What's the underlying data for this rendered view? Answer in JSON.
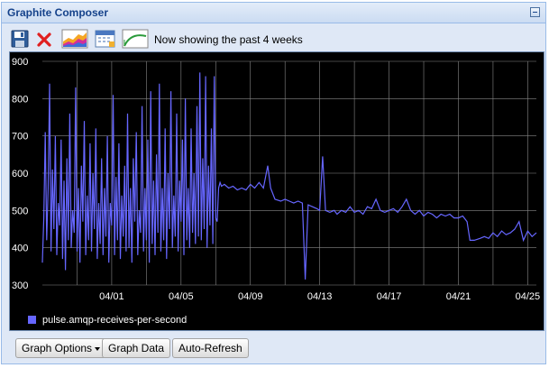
{
  "window": {
    "title": "Graphite Composer"
  },
  "toolbar": {
    "status": "Now showing the past 4 weeks",
    "icons": [
      "save-icon",
      "delete-icon",
      "graph-options-icon",
      "calendar-icon",
      "recent-range-icon"
    ]
  },
  "colors": {
    "background": "#000000",
    "series": "#6666ff",
    "grid": "#888888",
    "labels": "#ffffff"
  },
  "chart_data": {
    "type": "line",
    "title": "",
    "xlabel": "",
    "ylabel": "",
    "ylim": [
      300,
      900
    ],
    "xlim": [
      "2025-03-28",
      "2025-04-25"
    ],
    "yticks": [
      300,
      400,
      500,
      600,
      700,
      800,
      900
    ],
    "xticks": [
      "04/01",
      "04/05",
      "04/09",
      "04/13",
      "04/17",
      "04/21",
      "04/25"
    ],
    "grid": true,
    "legend": "bottom-left",
    "series": [
      {
        "name": "pulse.amqp-receives-per-second",
        "color": "#6666ff",
        "points": [
          [
            "2025-03-28 00:00",
            360
          ],
          [
            "2025-03-28 02:00",
            480
          ],
          [
            "2025-03-28 04:00",
            710
          ],
          [
            "2025-03-28 06:00",
            420
          ],
          [
            "2025-03-28 08:00",
            560
          ],
          [
            "2025-03-28 10:00",
            840
          ],
          [
            "2025-03-28 12:00",
            390
          ],
          [
            "2025-03-28 14:00",
            610
          ],
          [
            "2025-03-28 16:00",
            450
          ],
          [
            "2025-03-28 18:00",
            700
          ],
          [
            "2025-03-28 20:00",
            380
          ],
          [
            "2025-03-28 22:00",
            520
          ],
          [
            "2025-03-29 00:00",
            460
          ],
          [
            "2025-03-29 02:00",
            690
          ],
          [
            "2025-03-29 04:00",
            370
          ],
          [
            "2025-03-29 06:00",
            580
          ],
          [
            "2025-03-29 08:00",
            340
          ],
          [
            "2025-03-29 10:00",
            640
          ],
          [
            "2025-03-29 12:00",
            420
          ],
          [
            "2025-03-29 14:00",
            760
          ],
          [
            "2025-03-29 16:00",
            400
          ],
          [
            "2025-03-29 18:00",
            500
          ],
          [
            "2025-03-29 20:00",
            440
          ],
          [
            "2025-03-29 22:00",
            830
          ],
          [
            "2025-03-30 00:00",
            390
          ],
          [
            "2025-03-30 02:00",
            560
          ],
          [
            "2025-03-30 04:00",
            360
          ],
          [
            "2025-03-30 06:00",
            620
          ],
          [
            "2025-03-30 08:00",
            470
          ],
          [
            "2025-03-30 10:00",
            740
          ],
          [
            "2025-03-30 12:00",
            380
          ],
          [
            "2025-03-30 14:00",
            540
          ],
          [
            "2025-03-30 16:00",
            420
          ],
          [
            "2025-03-30 18:00",
            680
          ],
          [
            "2025-03-30 20:00",
            390
          ],
          [
            "2025-03-30 22:00",
            600
          ],
          [
            "2025-03-31 00:00",
            450
          ],
          [
            "2025-03-31 02:00",
            720
          ],
          [
            "2025-03-31 04:00",
            370
          ],
          [
            "2025-03-31 06:00",
            520
          ],
          [
            "2025-03-31 08:00",
            410
          ],
          [
            "2025-03-31 10:00",
            640
          ],
          [
            "2025-03-31 12:00",
            380
          ],
          [
            "2025-03-31 14:00",
            560
          ],
          [
            "2025-03-31 16:00",
            430
          ],
          [
            "2025-03-31 18:00",
            700
          ],
          [
            "2025-03-31 20:00",
            360
          ],
          [
            "2025-03-31 22:00",
            520
          ],
          [
            "2025-04-01 00:00",
            460
          ],
          [
            "2025-04-01 02:00",
            810
          ],
          [
            "2025-04-01 04:00",
            380
          ],
          [
            "2025-04-01 06:00",
            590
          ],
          [
            "2025-04-01 08:00",
            420
          ],
          [
            "2025-04-01 10:00",
            680
          ],
          [
            "2025-04-01 12:00",
            370
          ],
          [
            "2025-04-01 14:00",
            540
          ],
          [
            "2025-04-01 16:00",
            430
          ],
          [
            "2025-04-01 18:00",
            620
          ],
          [
            "2025-04-01 20:00",
            390
          ],
          [
            "2025-04-01 22:00",
            760
          ],
          [
            "2025-04-02 00:00",
            400
          ],
          [
            "2025-04-02 02:00",
            560
          ],
          [
            "2025-04-02 04:00",
            360
          ],
          [
            "2025-04-02 06:00",
            640
          ],
          [
            "2025-04-02 08:00",
            470
          ],
          [
            "2025-04-02 10:00",
            710
          ],
          [
            "2025-04-02 12:00",
            380
          ],
          [
            "2025-04-02 14:00",
            500
          ],
          [
            "2025-04-02 16:00",
            440
          ],
          [
            "2025-04-02 18:00",
            780
          ],
          [
            "2025-04-02 20:00",
            390
          ],
          [
            "2025-04-02 22:00",
            560
          ],
          [
            "2025-04-03 00:00",
            420
          ],
          [
            "2025-04-03 02:00",
            690
          ],
          [
            "2025-04-03 04:00",
            360
          ],
          [
            "2025-04-03 06:00",
            820
          ],
          [
            "2025-04-03 08:00",
            410
          ],
          [
            "2025-04-03 10:00",
            580
          ],
          [
            "2025-04-03 12:00",
            380
          ],
          [
            "2025-04-03 14:00",
            650
          ],
          [
            "2025-04-03 16:00",
            440
          ],
          [
            "2025-04-03 18:00",
            840
          ],
          [
            "2025-04-03 20:00",
            390
          ],
          [
            "2025-04-03 22:00",
            560
          ],
          [
            "2025-04-04 00:00",
            420
          ],
          [
            "2025-04-04 02:00",
            720
          ],
          [
            "2025-04-04 04:00",
            370
          ],
          [
            "2025-04-04 06:00",
            600
          ],
          [
            "2025-04-04 08:00",
            450
          ],
          [
            "2025-04-04 10:00",
            820
          ],
          [
            "2025-04-04 12:00",
            400
          ],
          [
            "2025-04-04 14:00",
            540
          ],
          [
            "2025-04-04 16:00",
            430
          ],
          [
            "2025-04-04 18:00",
            760
          ],
          [
            "2025-04-04 20:00",
            390
          ],
          [
            "2025-04-04 22:00",
            580
          ],
          [
            "2025-04-05 00:00",
            470
          ],
          [
            "2025-04-05 02:00",
            690
          ],
          [
            "2025-04-05 04:00",
            380
          ],
          [
            "2025-04-05 06:00",
            800
          ],
          [
            "2025-04-05 08:00",
            420
          ],
          [
            "2025-04-05 10:00",
            560
          ],
          [
            "2025-04-05 12:00",
            400
          ],
          [
            "2025-04-05 14:00",
            720
          ],
          [
            "2025-04-05 16:00",
            440
          ],
          [
            "2025-04-05 18:00",
            600
          ],
          [
            "2025-04-05 20:00",
            410
          ],
          [
            "2025-04-05 22:00",
            780
          ],
          [
            "2025-04-06 00:00",
            430
          ],
          [
            "2025-04-06 02:00",
            870
          ],
          [
            "2025-04-06 04:00",
            420
          ],
          [
            "2025-04-06 06:00",
            640
          ],
          [
            "2025-04-06 08:00",
            450
          ],
          [
            "2025-04-06 10:00",
            860
          ],
          [
            "2025-04-06 12:00",
            400
          ],
          [
            "2025-04-06 14:00",
            620
          ],
          [
            "2025-04-06 16:00",
            460
          ],
          [
            "2025-04-06 18:00",
            720
          ],
          [
            "2025-04-06 20:00",
            410
          ],
          [
            "2025-04-06 22:00",
            860
          ],
          [
            "2025-04-07 00:00",
            480
          ],
          [
            "2025-04-07 02:00",
            470
          ],
          [
            "2025-04-07 04:00",
            560
          ],
          [
            "2025-04-07 06:00",
            575
          ],
          [
            "2025-04-07 08:00",
            565
          ],
          [
            "2025-04-07 12:00",
            570
          ],
          [
            "2025-04-07 18:00",
            560
          ],
          [
            "2025-04-08 00:00",
            565
          ],
          [
            "2025-04-08 06:00",
            555
          ],
          [
            "2025-04-08 12:00",
            560
          ],
          [
            "2025-04-08 18:00",
            555
          ],
          [
            "2025-04-09 00:00",
            570
          ],
          [
            "2025-04-09 06:00",
            560
          ],
          [
            "2025-04-09 12:00",
            575
          ],
          [
            "2025-04-09 18:00",
            560
          ],
          [
            "2025-04-10 00:00",
            620
          ],
          [
            "2025-04-10 04:00",
            560
          ],
          [
            "2025-04-10 10:00",
            530
          ],
          [
            "2025-04-10 18:00",
            525
          ],
          [
            "2025-04-11 00:00",
            530
          ],
          [
            "2025-04-11 06:00",
            525
          ],
          [
            "2025-04-11 12:00",
            520
          ],
          [
            "2025-04-11 18:00",
            525
          ],
          [
            "2025-04-12 00:00",
            520
          ],
          [
            "2025-04-12 04:00",
            315
          ],
          [
            "2025-04-12 08:00",
            515
          ],
          [
            "2025-04-12 14:00",
            510
          ],
          [
            "2025-04-12 20:00",
            505
          ],
          [
            "2025-04-13 00:00",
            500
          ],
          [
            "2025-04-13 04:00",
            645
          ],
          [
            "2025-04-13 08:00",
            500
          ],
          [
            "2025-04-13 14:00",
            495
          ],
          [
            "2025-04-13 20:00",
            500
          ],
          [
            "2025-04-14 00:00",
            490
          ],
          [
            "2025-04-14 06:00",
            500
          ],
          [
            "2025-04-14 12:00",
            495
          ],
          [
            "2025-04-14 18:00",
            510
          ],
          [
            "2025-04-15 00:00",
            495
          ],
          [
            "2025-04-15 06:00",
            500
          ],
          [
            "2025-04-15 12:00",
            490
          ],
          [
            "2025-04-15 18:00",
            510
          ],
          [
            "2025-04-16 00:00",
            505
          ],
          [
            "2025-04-16 06:00",
            530
          ],
          [
            "2025-04-16 12:00",
            500
          ],
          [
            "2025-04-16 18:00",
            495
          ],
          [
            "2025-04-17 00:00",
            500
          ],
          [
            "2025-04-17 06:00",
            505
          ],
          [
            "2025-04-17 12:00",
            495
          ],
          [
            "2025-04-17 18:00",
            510
          ],
          [
            "2025-04-18 00:00",
            530
          ],
          [
            "2025-04-18 06:00",
            500
          ],
          [
            "2025-04-18 12:00",
            490
          ],
          [
            "2025-04-18 18:00",
            500
          ],
          [
            "2025-04-19 00:00",
            485
          ],
          [
            "2025-04-19 06:00",
            495
          ],
          [
            "2025-04-19 12:00",
            490
          ],
          [
            "2025-04-19 18:00",
            480
          ],
          [
            "2025-04-20 00:00",
            490
          ],
          [
            "2025-04-20 06:00",
            485
          ],
          [
            "2025-04-20 12:00",
            490
          ],
          [
            "2025-04-20 18:00",
            480
          ],
          [
            "2025-04-21 00:00",
            480
          ],
          [
            "2025-04-21 06:00",
            485
          ],
          [
            "2025-04-21 12:00",
            470
          ],
          [
            "2025-04-21 16:00",
            420
          ],
          [
            "2025-04-21 22:00",
            420
          ],
          [
            "2025-04-22 06:00",
            425
          ],
          [
            "2025-04-22 12:00",
            430
          ],
          [
            "2025-04-22 18:00",
            425
          ],
          [
            "2025-04-23 00:00",
            440
          ],
          [
            "2025-04-23 06:00",
            430
          ],
          [
            "2025-04-23 12:00",
            445
          ],
          [
            "2025-04-23 18:00",
            435
          ],
          [
            "2025-04-24 00:00",
            440
          ],
          [
            "2025-04-24 06:00",
            450
          ],
          [
            "2025-04-24 12:00",
            470
          ],
          [
            "2025-04-24 18:00",
            420
          ],
          [
            "2025-04-25 00:00",
            445
          ],
          [
            "2025-04-25 06:00",
            430
          ],
          [
            "2025-04-25 12:00",
            440
          ]
        ]
      }
    ]
  },
  "buttons": {
    "graph_options": "Graph Options",
    "graph_data": "Graph Data",
    "auto_refresh": "Auto-Refresh"
  }
}
